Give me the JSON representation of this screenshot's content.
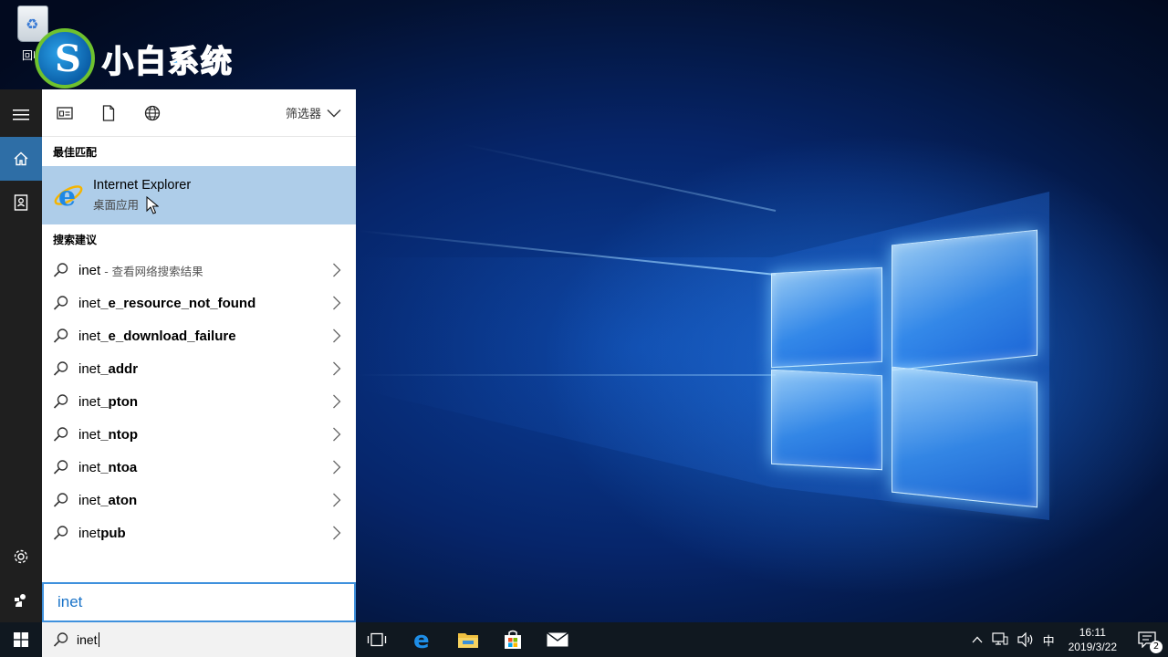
{
  "desktop": {
    "recycle_bin_label": "回收",
    "watermark_text": "小白系统",
    "watermark_glyph": "S"
  },
  "rail": {
    "items": [
      {
        "name": "menu",
        "icon": "hamburger-icon"
      },
      {
        "name": "home",
        "icon": "home-icon",
        "active": true
      },
      {
        "name": "notebook",
        "icon": "notebook-icon"
      },
      {
        "name": "settings",
        "icon": "gear-icon"
      },
      {
        "name": "feedback",
        "icon": "feedback-icon"
      }
    ]
  },
  "search_panel": {
    "scopes": [
      {
        "name": "apps",
        "icon": "apps-icon"
      },
      {
        "name": "documents",
        "icon": "document-icon"
      },
      {
        "name": "web",
        "icon": "globe-icon"
      }
    ],
    "filter_label": "筛选器",
    "best_match_title": "最佳匹配",
    "best_match": {
      "name": "Internet Explorer",
      "type": "桌面应用",
      "icon": "internet-explorer-icon"
    },
    "suggestions_title": "搜索建议",
    "suggestions": [
      {
        "prefix": "inet",
        "bold": "",
        "hint": "- 查看网络搜索结果"
      },
      {
        "prefix": "inet",
        "bold": "_e_resource_not_found",
        "hint": ""
      },
      {
        "prefix": "inet",
        "bold": "_e_download_failure",
        "hint": ""
      },
      {
        "prefix": "inet",
        "bold": "_addr",
        "hint": ""
      },
      {
        "prefix": "inet",
        "bold": "_pton",
        "hint": ""
      },
      {
        "prefix": "inet",
        "bold": "_ntop",
        "hint": ""
      },
      {
        "prefix": "inet",
        "bold": "_ntoa",
        "hint": ""
      },
      {
        "prefix": "inet",
        "bold": "_aton",
        "hint": ""
      },
      {
        "prefix": "inet",
        "bold": "pub",
        "hint": ""
      }
    ],
    "query_display": "inet"
  },
  "taskbar": {
    "search_value": "inet",
    "apps": [
      {
        "name": "task-view",
        "icon": "task-view-icon"
      },
      {
        "name": "edge",
        "icon": "edge-icon"
      },
      {
        "name": "file-explorer",
        "icon": "folder-icon"
      },
      {
        "name": "store",
        "icon": "store-icon"
      },
      {
        "name": "mail",
        "icon": "mail-icon"
      }
    ],
    "tray": {
      "ime": "中",
      "time": "16:11",
      "date": "2019/3/22",
      "notification_count": "2"
    }
  },
  "colors": {
    "highlight": "#aecde9",
    "accent": "#3f91dd",
    "rail_active": "#2e6ea6",
    "taskbar": "#101820"
  }
}
